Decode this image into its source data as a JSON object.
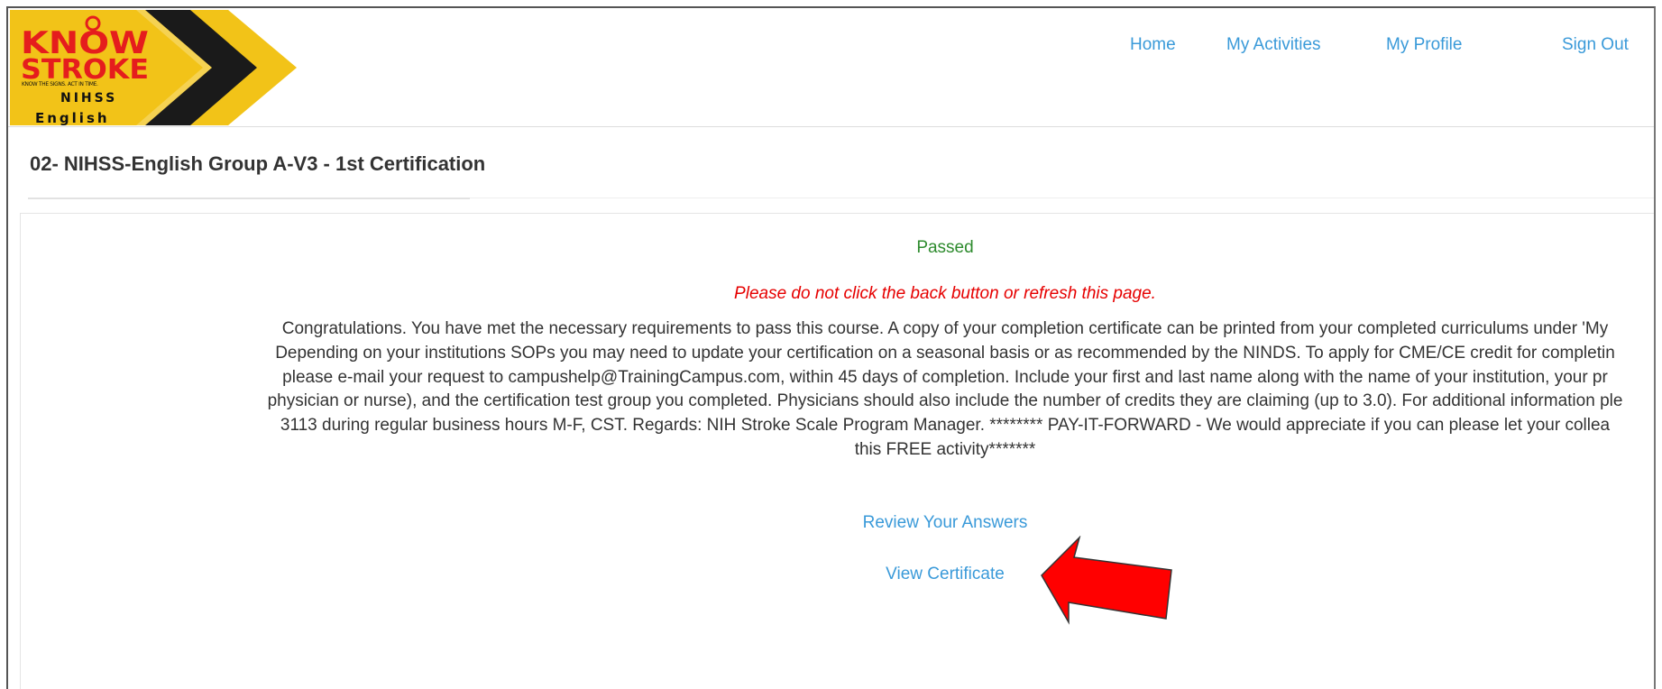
{
  "logo": {
    "brand_line1": "KNOW",
    "brand_line2": "STROKE",
    "tagline": "KNOW THE SIGNS. ACT IN TIME.",
    "product": "NIHSS",
    "language": "English"
  },
  "nav": {
    "home": "Home",
    "activities": "My Activities",
    "profile": "My Profile",
    "signout": "Sign Out"
  },
  "page": {
    "title": "02- NIHSS-English Group A-V3 - 1st Certification"
  },
  "result": {
    "status": "Passed",
    "warning": "Please do not click the back button or refresh this page.",
    "message_lines": [
      "Congratulations. You have met the necessary requirements to pass this course. A copy of your completion certificate can be printed from your completed curriculums under 'My",
      "Depending on your institutions SOPs you may need to update your certification on a seasonal basis or as recommended by the NINDS. To apply for CME/CE credit for completin",
      "please e-mail your request to campushelp@TrainingCampus.com, within 45 days of completion. Include your first and last name along with the name of your institution, your pr",
      "physician or nurse), and the certification test group you completed. Physicians should also include the number of credits they are claiming (up to 3.0). For additional information ple",
      "3113 during regular business hours M-F, CST. Regards: NIH Stroke Scale Program Manager. ******** PAY-IT-FORWARD - We would appreciate if you can please let your collea",
      "this FREE activity*******"
    ],
    "review_link": "Review Your Answers",
    "certificate_link": "View Certificate"
  },
  "colors": {
    "link": "#3a9ad9",
    "passed": "#2e8b2e",
    "warning": "#e60000",
    "annotation_arrow": "#ff0000",
    "logo_yellow": "#f2c318",
    "logo_red": "#e51d1d"
  }
}
